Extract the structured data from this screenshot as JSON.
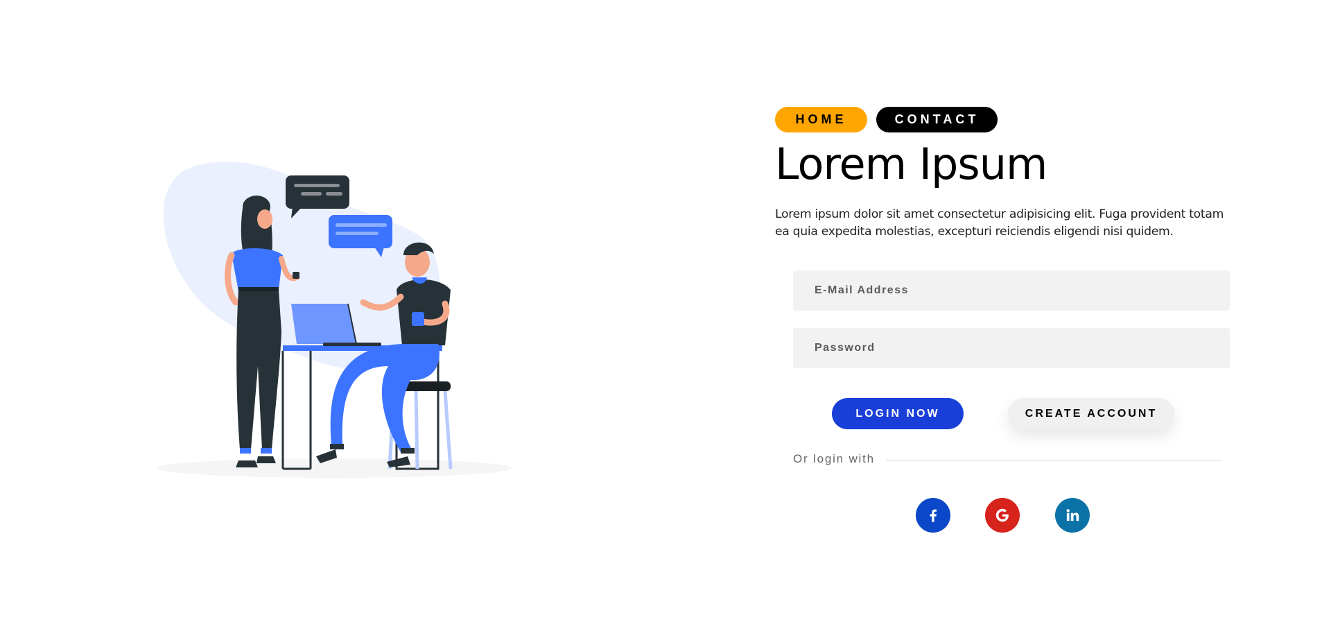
{
  "nav": {
    "home_label": "HOME",
    "contact_label": "CONTACT"
  },
  "hero": {
    "title": "Lorem Ipsum",
    "description": "Lorem ipsum dolor sit amet consectetur adipisicing elit. Fuga provident totam ea quia expedita molestias, excepturi reiciendis eligendi nisi quidem."
  },
  "form": {
    "email_placeholder": "E-Mail Address",
    "email_value": "",
    "password_placeholder": "Password",
    "password_value": "",
    "login_label": "LOGIN NOW",
    "create_label": "CREATE ACCOUNT",
    "or_login_with": "Or login with"
  },
  "social": [
    {
      "name": "facebook",
      "icon": "facebook-icon",
      "color": "#0A48C9"
    },
    {
      "name": "google",
      "icon": "google-icon",
      "color": "#D6231B"
    },
    {
      "name": "linkedin",
      "icon": "linkedin-icon",
      "color": "#0B72A8"
    }
  ],
  "colors": {
    "home_pill": "#FFA500",
    "contact_pill": "#000000",
    "login_button": "#1A3FD9",
    "create_button": "#F0F0F0",
    "illustration_blue": "#3D74FF",
    "illustration_dark": "#263238",
    "blob": "#EBF0FF"
  },
  "illustration": {
    "description_icon": "people-chatting-at-desk-illustration"
  }
}
